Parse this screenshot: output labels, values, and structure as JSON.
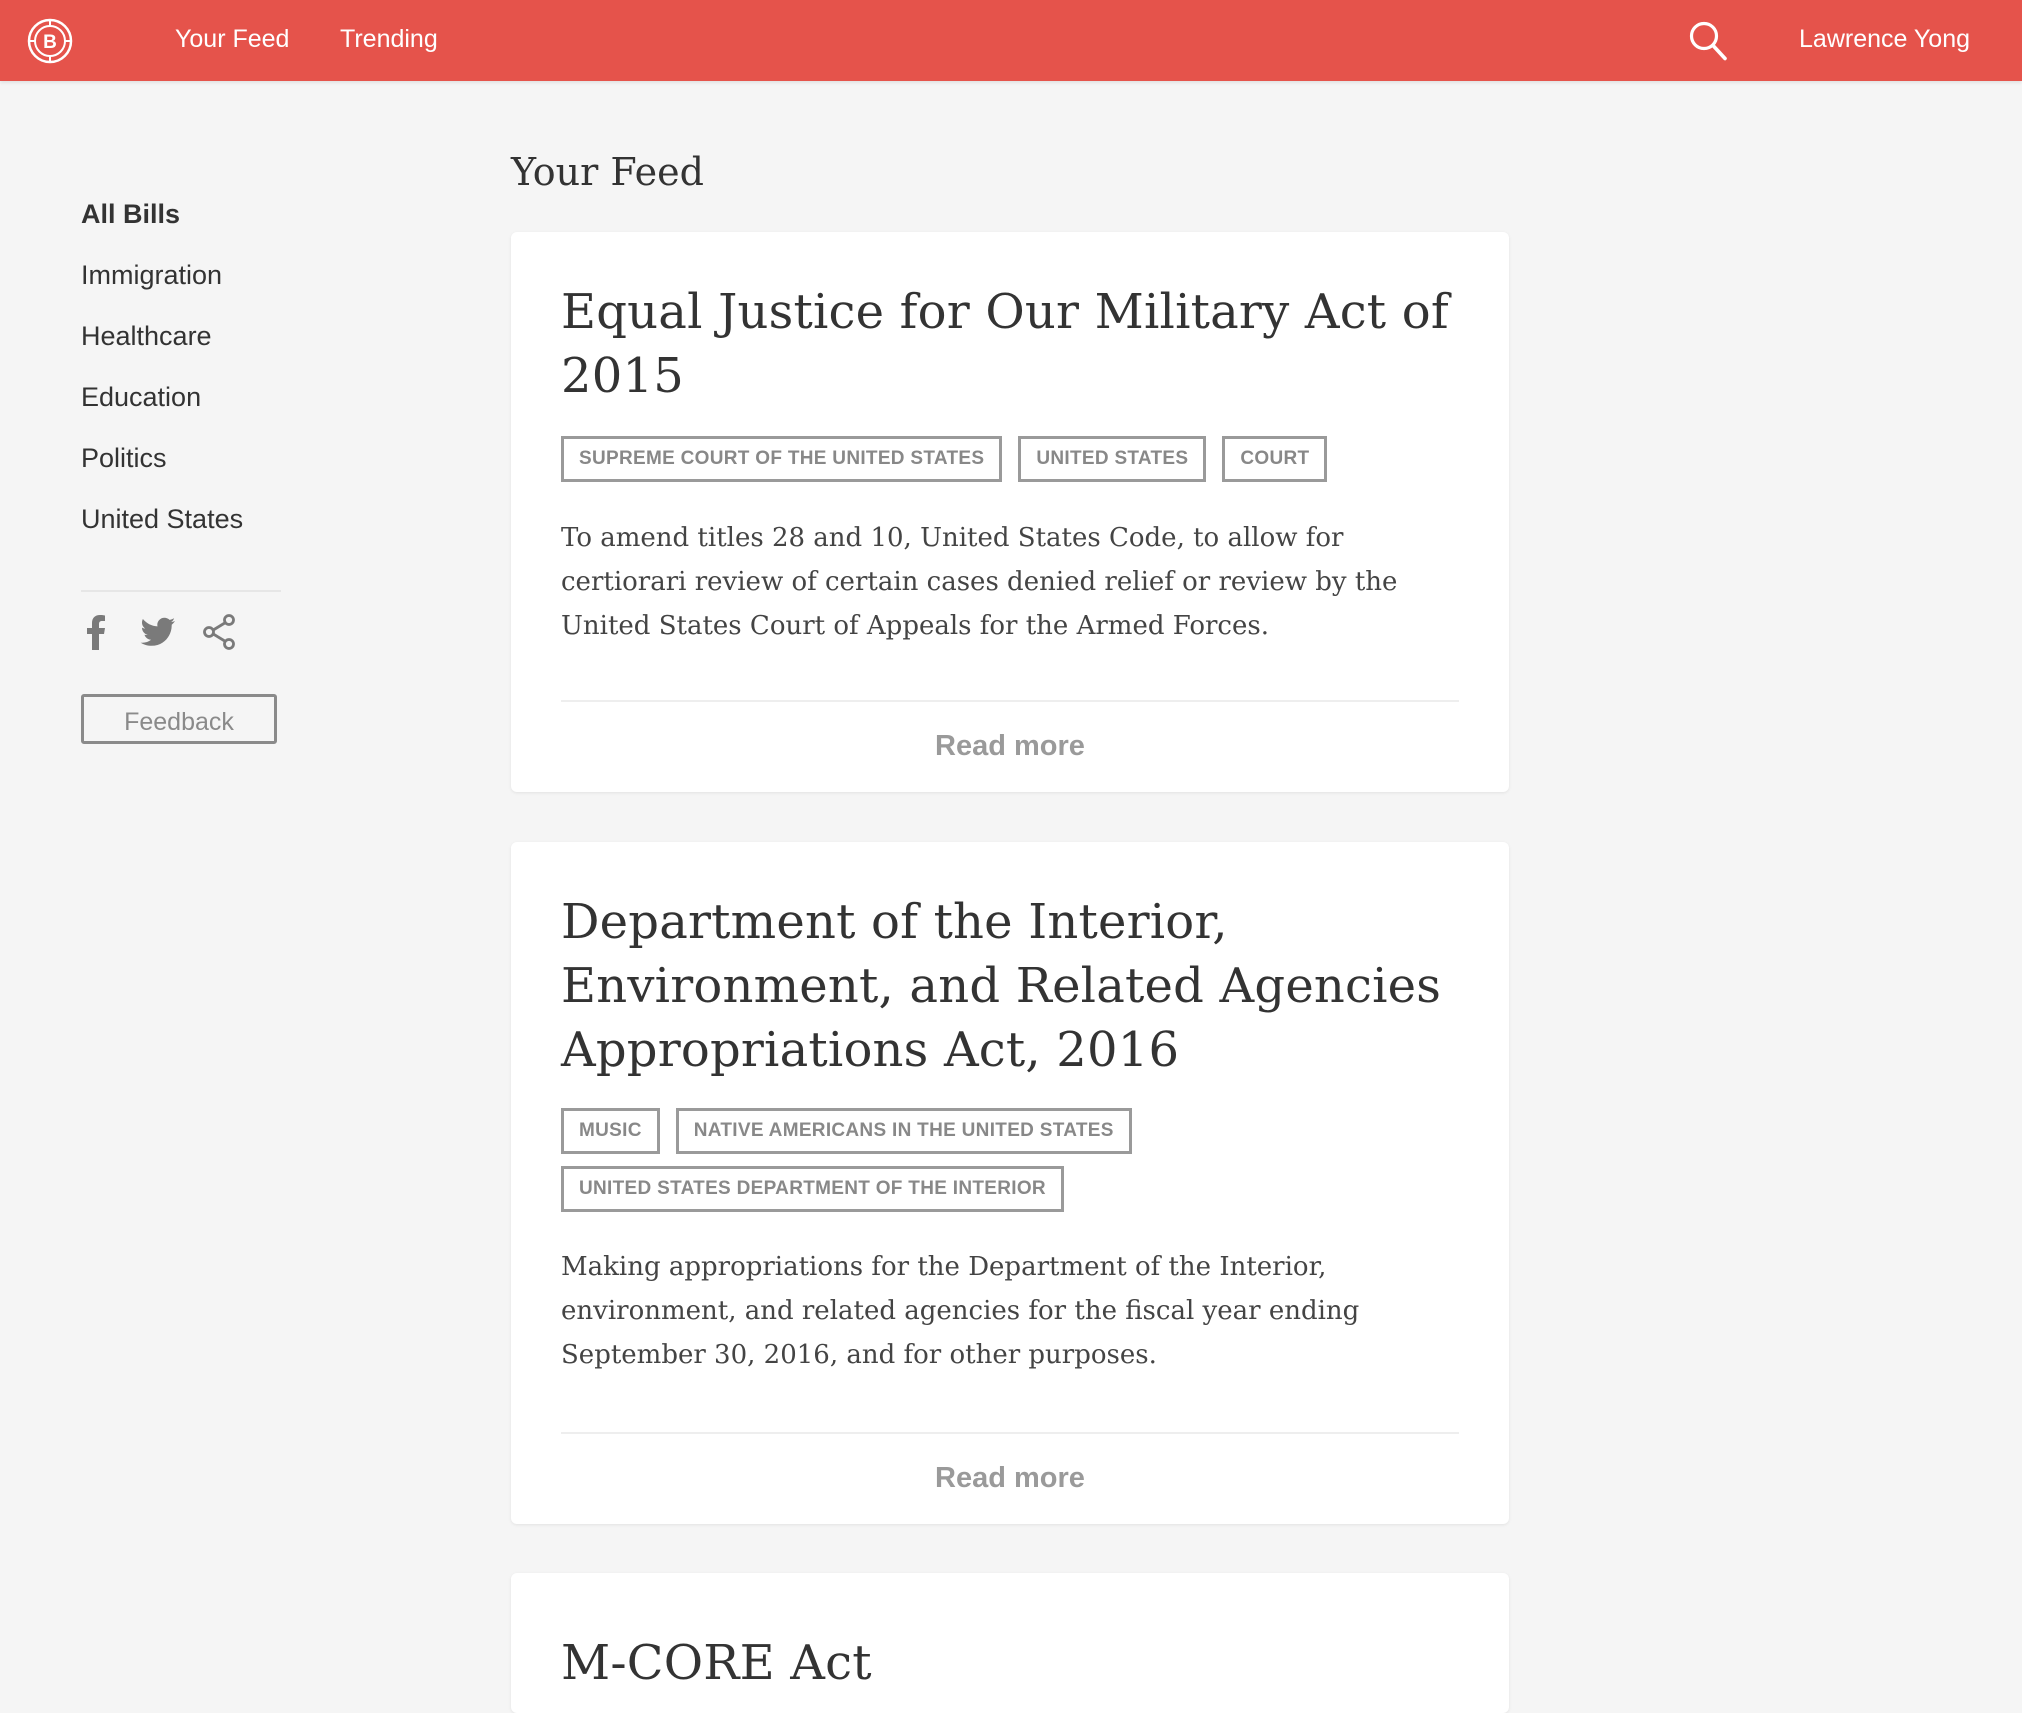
{
  "header": {
    "logo_letter": "B",
    "nav": [
      {
        "label": "Your Feed"
      },
      {
        "label": "Trending"
      }
    ],
    "search_icon": "search-icon",
    "user_name": "Lawrence Yong",
    "bar_color": "#e5534b"
  },
  "sidebar": {
    "categories": [
      {
        "label": "All Bills",
        "active": true
      },
      {
        "label": "Immigration"
      },
      {
        "label": "Healthcare"
      },
      {
        "label": "Education"
      },
      {
        "label": "Politics"
      },
      {
        "label": "United States"
      }
    ],
    "social_icons": [
      "facebook-icon",
      "twitter-icon",
      "share-icon"
    ],
    "feedback_label": "Feedback"
  },
  "main": {
    "title": "Your Feed",
    "bills": [
      {
        "title": "Equal Justice for Our Military Act of 2015",
        "tags": [
          "Supreme Court of the United States",
          "United States",
          "Court"
        ],
        "summary": "To amend titles 28 and 10, United States Code, to allow for certiorari review of certain cases denied relief or review by the United States Court of Appeals for the Armed Forces.",
        "read_more": "Read more"
      },
      {
        "title": "Department of the Interior, Environment, and Related Agencies Appropriations Act, 2016",
        "tags": [
          "Music",
          "Native Americans in the United States",
          "United States Department of the Interior"
        ],
        "summary": "Making appropriations for the Department of the Interior, environment, and related agencies for the fiscal year ending September 30, 2016, and for other purposes.",
        "read_more": "Read more"
      },
      {
        "title": "M-CORE Act"
      }
    ]
  }
}
